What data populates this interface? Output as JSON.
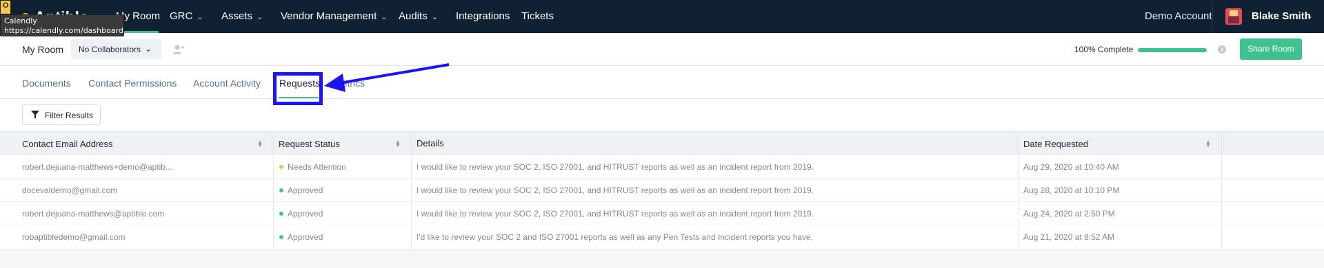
{
  "app": {
    "logo_text": "Aptible"
  },
  "tooltip": {
    "title": "Calendly",
    "url": "https://calendly.com/dashboard"
  },
  "topnav": {
    "items": [
      {
        "label": "My Room"
      },
      {
        "label": "GRC"
      },
      {
        "label": "Assets"
      },
      {
        "label": "Vendor Management"
      },
      {
        "label": "Audits"
      },
      {
        "label": "Integrations"
      },
      {
        "label": "Tickets"
      }
    ],
    "account_label": "Demo Account",
    "user_name": "Blake Smith"
  },
  "subbar": {
    "room_title": "My Room",
    "collaborators_label": "No Collaborators",
    "progress_label": "100% Complete",
    "progress_fraction": 1.0,
    "share_label": "Share Room"
  },
  "tabs": [
    {
      "label": "Documents"
    },
    {
      "label": "Contact Permissions"
    },
    {
      "label": "Account Activity"
    },
    {
      "label": "Requests"
    },
    {
      "label": "Metrics"
    }
  ],
  "filter": {
    "label": "Filter Results"
  },
  "table": {
    "columns": [
      "Contact Email Address",
      "Request Status",
      "Details",
      "Date Requested"
    ],
    "rows": [
      {
        "email": "robert.dejuana-matthews+demo@aptib...",
        "status": "Needs Attention",
        "status_color": "#f2c14e",
        "details": "I would like to review your SOC 2, ISO 27001, and HITRUST reports as well as an incident report from 2019.",
        "date": "Aug 29, 2020 at 10:40 AM"
      },
      {
        "email": "docevaldemo@gmail.com",
        "status": "Approved",
        "status_color": "#3fc28f",
        "details": "I would like to review your SOC 2, ISO 27001, and HITRUST reports as well as an incident report from 2019.",
        "date": "Aug 28, 2020 at 10:10 PM"
      },
      {
        "email": "robert.dejuana-matthews@aptible.com",
        "status": "Approved",
        "status_color": "#3fc28f",
        "details": "I would like to review your SOC 2, ISO 27001, and HITRUST reports as well as an incident report from 2019.",
        "date": "Aug 24, 2020 at 2:50 PM"
      },
      {
        "email": "robaptibledemo@gmail.com",
        "status": "Approved",
        "status_color": "#3fc28f",
        "details": "I'd like to review your SOC 2 and ISO 27001 reports as well as any Pen Tests and Incident reports you have.",
        "date": "Aug 21, 2020 at 8:52 AM"
      }
    ]
  },
  "annotation": {
    "highlight_color": "#1c14f2"
  }
}
